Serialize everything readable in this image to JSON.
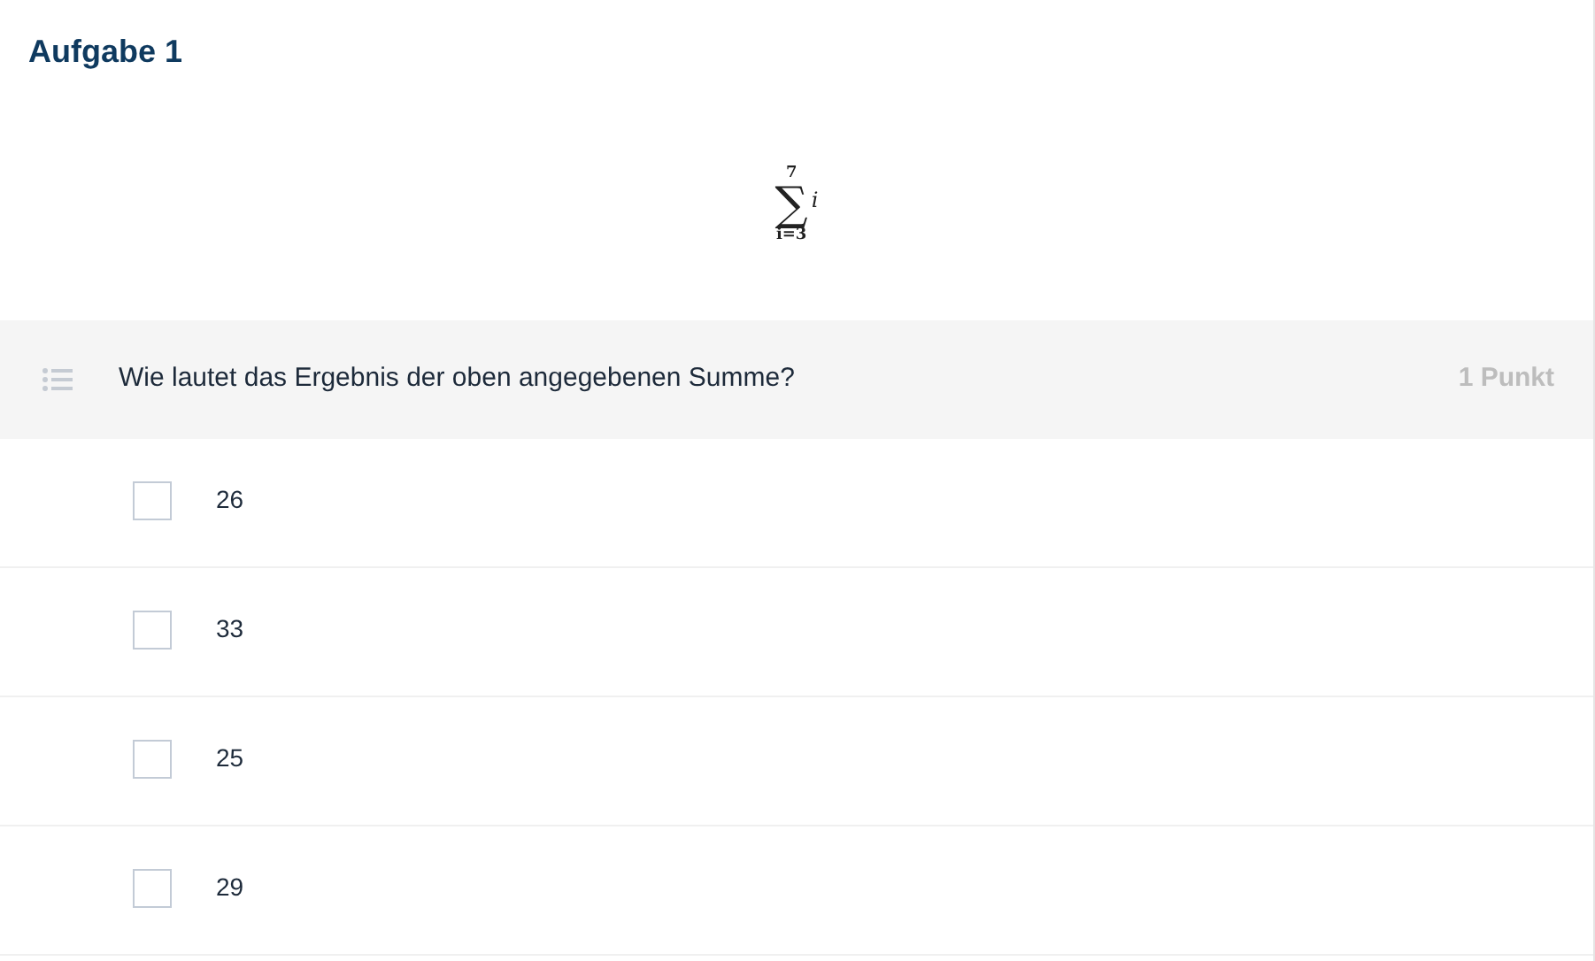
{
  "title": "Aufgabe 1",
  "formula": {
    "symbol": "∑",
    "upper": "7",
    "lower": "i=3",
    "term": "i"
  },
  "question": {
    "text": "Wie lautet das Ergebnis der oben angegebenen Summe?",
    "points": "1 Punkt"
  },
  "options": [
    {
      "label": "26",
      "checked": false
    },
    {
      "label": "33",
      "checked": false
    },
    {
      "label": "25",
      "checked": false
    },
    {
      "label": "29",
      "checked": false
    }
  ]
}
